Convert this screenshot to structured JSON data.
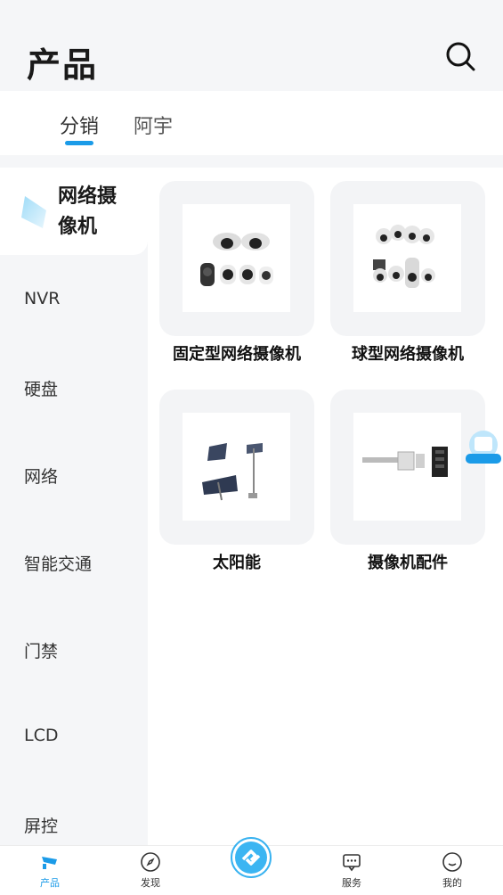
{
  "header": {
    "title": "产品"
  },
  "tabs": [
    {
      "label": "分销"
    },
    {
      "label": "阿宇"
    }
  ],
  "sidebar": {
    "active": {
      "label": "网络摄像机"
    },
    "items": [
      {
        "label": "NVR"
      },
      {
        "label": "硬盘"
      },
      {
        "label": "网络"
      },
      {
        "label": "智能交通"
      },
      {
        "label": "门禁"
      },
      {
        "label": "LCD"
      },
      {
        "label": "屏控"
      }
    ]
  },
  "products": [
    {
      "name": "固定型网络摄像机"
    },
    {
      "name": "球型网络摄像机"
    },
    {
      "name": "太阳能"
    },
    {
      "name": "摄像机配件"
    }
  ],
  "nav": [
    {
      "label": "产品"
    },
    {
      "label": "发现"
    },
    {
      "label": "服务"
    },
    {
      "label": "我的"
    }
  ],
  "colors": {
    "accent": "#1b9be8",
    "background": "#f5f6f8"
  }
}
